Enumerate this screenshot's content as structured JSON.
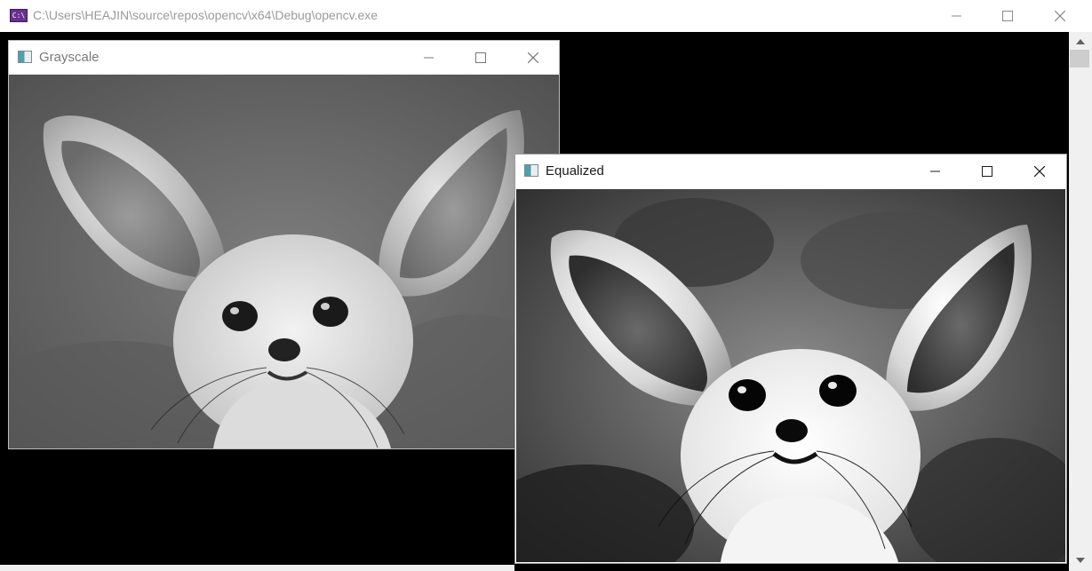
{
  "console": {
    "title": "C:\\Users\\HEAJIN\\source\\repos\\opencv\\x64\\Debug\\opencv.exe",
    "icon_label": "C:\\",
    "icon": "console-app-icon",
    "controls": [
      "minimize-icon",
      "maximize-icon",
      "close-icon"
    ]
  },
  "windows": {
    "grayscale": {
      "title": "Grayscale",
      "icon": "image-window-icon",
      "image_description": "grayscale photo of a fennec fox with large ears"
    },
    "equalized": {
      "title": "Equalized",
      "icon": "image-window-icon",
      "image_description": "histogram-equalized grayscale photo of a fennec fox"
    }
  },
  "colors": {
    "console_bg": "#000000",
    "titlebar_bg": "#ffffff",
    "inactive_title": "#7a7a7a",
    "active_title": "#1a1a1a"
  }
}
